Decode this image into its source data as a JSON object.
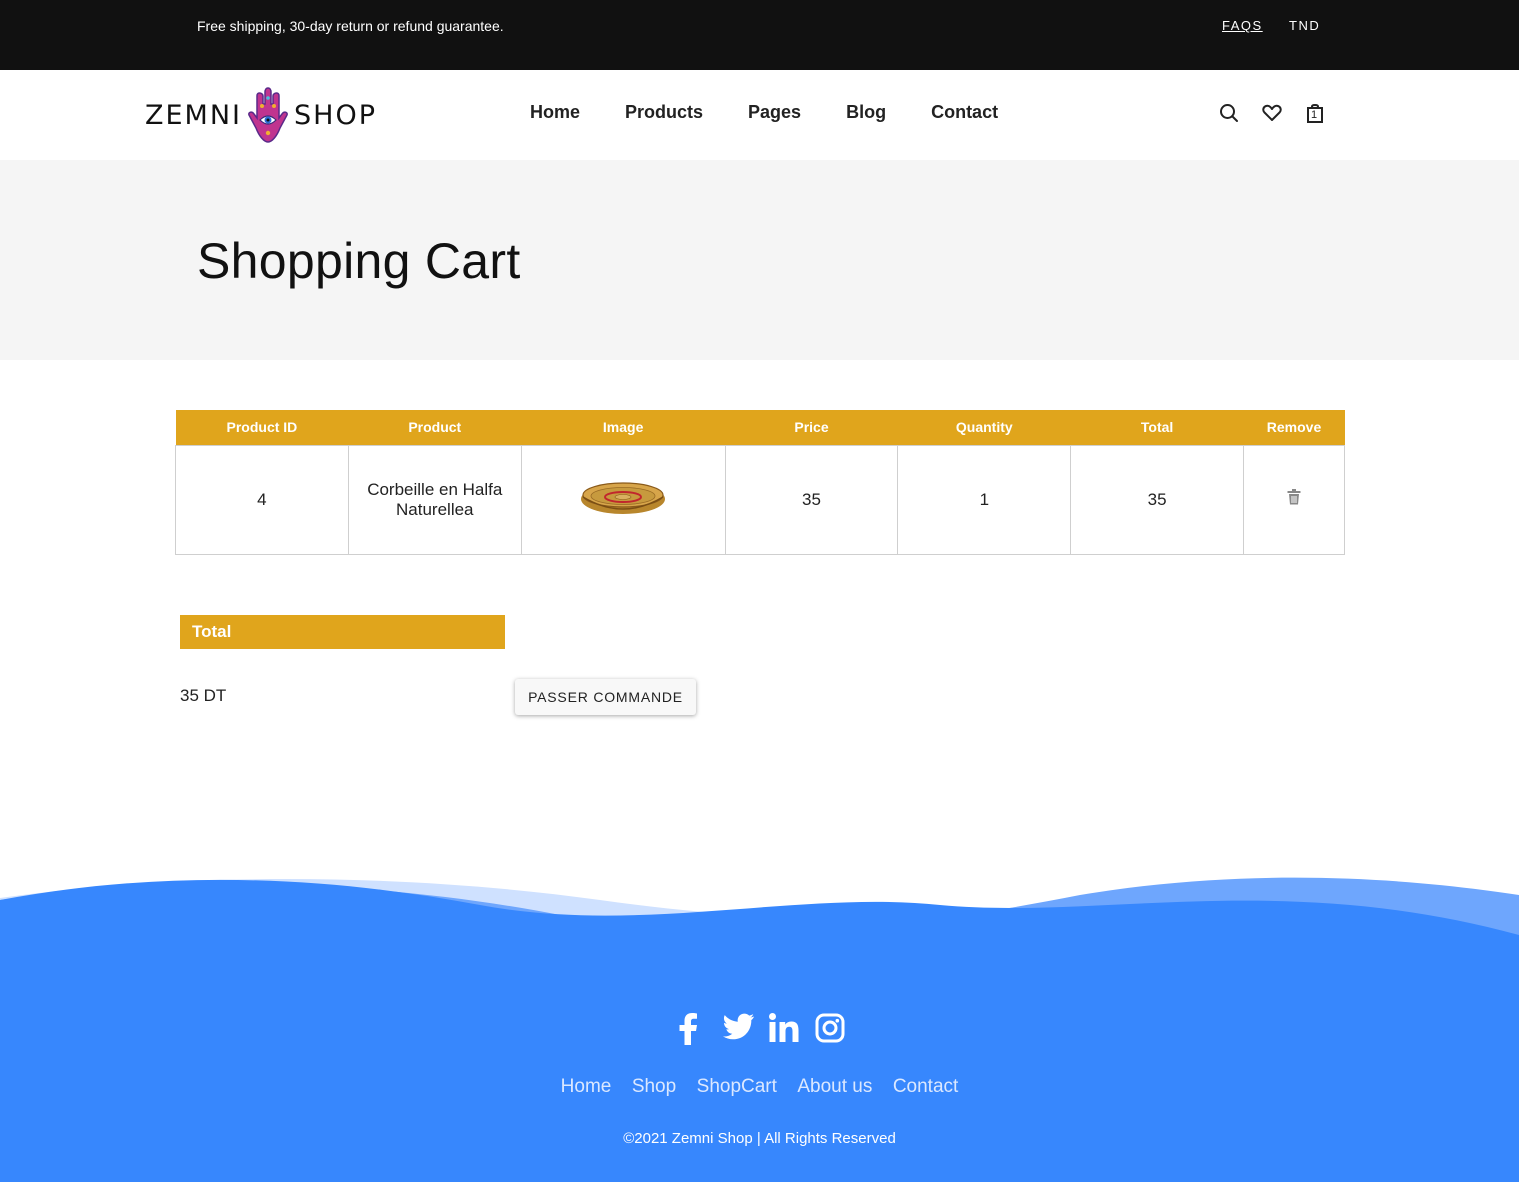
{
  "topbar": {
    "promo": "Free shipping, 30-day return or refund guarantee.",
    "faqs": "FAQS",
    "currency": "TND"
  },
  "header": {
    "logo_left": "ZEMNI",
    "logo_right": "SHOP",
    "nav": [
      "Home",
      "Products",
      "Pages",
      "Blog",
      "Contact"
    ],
    "icons": [
      "search-icon",
      "heart-icon",
      "shopping-bag-icon"
    ],
    "cart_count": "1"
  },
  "banner": {
    "title": "Shopping Cart"
  },
  "cart": {
    "columns": [
      "Product ID",
      "Product",
      "Image",
      "Price",
      "Quantity",
      "Total",
      "Remove"
    ],
    "rows": [
      {
        "id": "4",
        "product": "Corbeille en Halfa Naturellea",
        "image": "basket-image",
        "price": "35",
        "quantity": "1",
        "total": "35"
      }
    ]
  },
  "summary": {
    "heading": "Total",
    "value": "35 DT",
    "button": "PASSER COMMANDE"
  },
  "footer": {
    "social": [
      "facebook-icon",
      "twitter-icon",
      "linkedin-icon",
      "instagram-icon"
    ],
    "links": [
      "Home",
      "Shop",
      "ShopCart",
      "About us",
      "Contact"
    ],
    "copyright": "©2021 Zemni Shop | All Rights Reserved"
  },
  "colors": {
    "topbar_bg": "#111111",
    "accent": "#e0a51c",
    "banner_bg": "#f5f5f5",
    "footer_bg": "#3787fd"
  }
}
